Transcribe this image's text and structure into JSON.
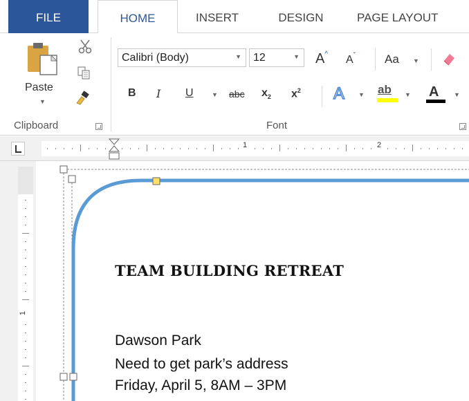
{
  "ribbon_tabs": {
    "file": "FILE",
    "home": "HOME",
    "insert": "INSERT",
    "design": "DESIGN",
    "page_layout": "PAGE LAYOUT"
  },
  "clipboard": {
    "paste_label": "Paste",
    "group_label": "Clipboard"
  },
  "font": {
    "font_name": "Calibri (Body)",
    "font_size": "12",
    "change_case": "Aa",
    "group_label": "Font",
    "bold": "B",
    "italic": "I",
    "underline": "U",
    "strikethrough": "abc",
    "subscript": "x",
    "subscript_mark": "2",
    "superscript": "x",
    "superscript_mark": "2",
    "text_effects": "A",
    "highlight": "ab",
    "font_color": "A",
    "highlight_color": "#ffff00",
    "font_color_value": "#000000"
  },
  "ruler": {
    "labels": [
      "1",
      "2"
    ]
  },
  "document": {
    "title": "TEAM BUILDING RETREAT",
    "lines": [
      "Dawson Park",
      "Need to get park’s address",
      "Friday, April 5, 8AM – 3PM"
    ],
    "shape_outline_color": "#5b9bd5"
  },
  "colors": {
    "file_tab": "#2b579a",
    "accent": "#2b579a"
  }
}
